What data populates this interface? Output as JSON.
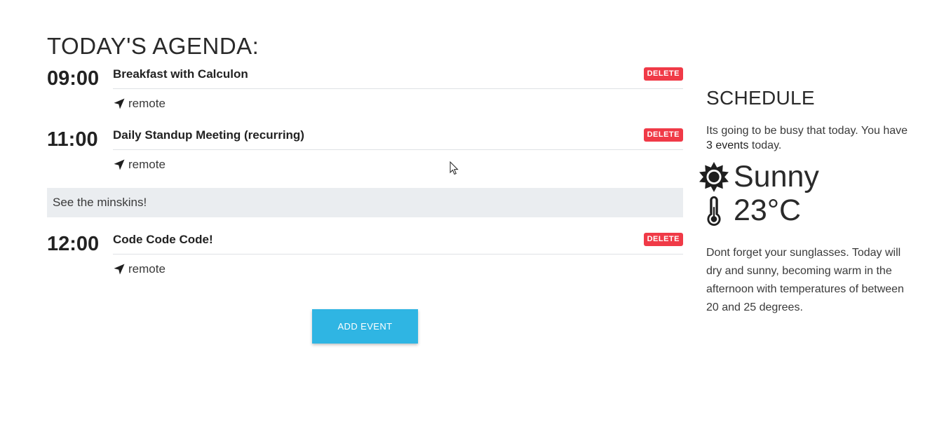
{
  "agenda": {
    "title": "TODAY'S AGENDA:",
    "events": [
      {
        "time": "09:00",
        "title": "Breakfast with Calculon",
        "delete_label": "DELETE",
        "location": "remote"
      },
      {
        "time": "11:00",
        "title": "Daily Standup Meeting (recurring)",
        "delete_label": "DELETE",
        "location": "remote"
      },
      {
        "time": "12:00",
        "title": "Code Code Code!",
        "delete_label": "DELETE",
        "location": "remote"
      }
    ],
    "note": "See the minskins!",
    "add_label": "ADD EVENT"
  },
  "schedule": {
    "title": "SCHEDULE",
    "summary_prefix": "Its going to be busy that today. You have ",
    "summary_count": "3 events",
    "summary_suffix": " today.",
    "condition": "Sunny",
    "temperature": "23°C",
    "description": "Dont forget your sunglasses. Today will dry and sunny, becoming warm in the afternoon with temperatures of between 20 and 25 degrees."
  },
  "icons": {
    "location": "location-arrow-icon",
    "weather": "sun-icon",
    "temperature": "thermometer-icon",
    "cursor": "mouse-cursor-icon"
  },
  "colors": {
    "delete": "#f03a47",
    "add_button": "#2fb5e3",
    "note_bg": "#eaedf0"
  }
}
